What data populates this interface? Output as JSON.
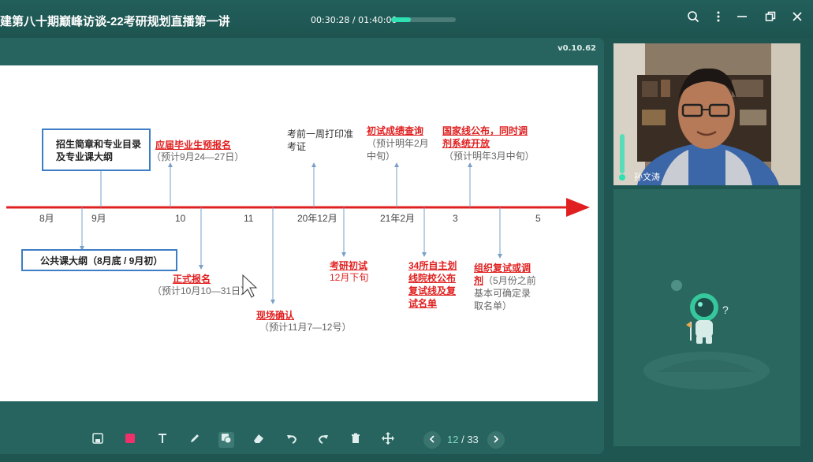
{
  "window": {
    "title": "建第八十期巅峰访谈-22考研规划直播第一讲",
    "time_current": "00:30:28",
    "time_sep": " / ",
    "time_total": "01:40:00",
    "progress_fraction": 0.305
  },
  "slide": {
    "version": "v0.10.62",
    "ticks": [
      "8月",
      "9月",
      "10",
      "11",
      "20年12月",
      "21年2月",
      "3",
      "5"
    ],
    "above": {
      "box1_line1": "招生简章和专业目录",
      "box1_line2": "及专业课大纲",
      "prereg_title": "应届毕业生预报名",
      "prereg_sub": "（预计9月24—27日）",
      "print_line1": "考前一周打印准",
      "print_line2": "考证",
      "score_title": "初试成绩查询",
      "score_sub1": "（预计明年2月",
      "score_sub2": "中旬）",
      "national_line1": "国家线公布，同时调",
      "national_line2": "剂系统开放",
      "national_sub": "（预计明年3月中旬）"
    },
    "below": {
      "box2": "公共课大纲（8月底 / 9月初）",
      "reg_title": "正式报名",
      "reg_sub": "（预计10月10—31日）",
      "confirm_title": "现场确认",
      "confirm_sub": "（预计11月7—12号）",
      "exam_title": "考研初试",
      "exam_sub": "12月下旬",
      "school_line1": "34所自主划",
      "school_line2": "线院校公布",
      "school_line3": "复试线及复",
      "school_line4": "试名单",
      "retest_line1": "组织复试或调",
      "retest_line2": "剂",
      "retest_line2b": "（5月份之前",
      "retest_line3": "基本可确定录",
      "retest_line4": "取名单）"
    },
    "colors": {
      "timeline": "#e02020",
      "box_border": "#3d7ec6",
      "pointer": "#7aa0c8"
    }
  },
  "toolbar": {
    "tools": [
      "save-icon",
      "color-square-icon",
      "text-icon",
      "pen-icon",
      "shape-icon",
      "eraser-icon",
      "undo-icon",
      "redo-icon",
      "trash-icon",
      "move-icon"
    ],
    "page_current": "12",
    "page_sep": " / ",
    "page_total": "33"
  },
  "video": {
    "name": "孙文涛"
  }
}
